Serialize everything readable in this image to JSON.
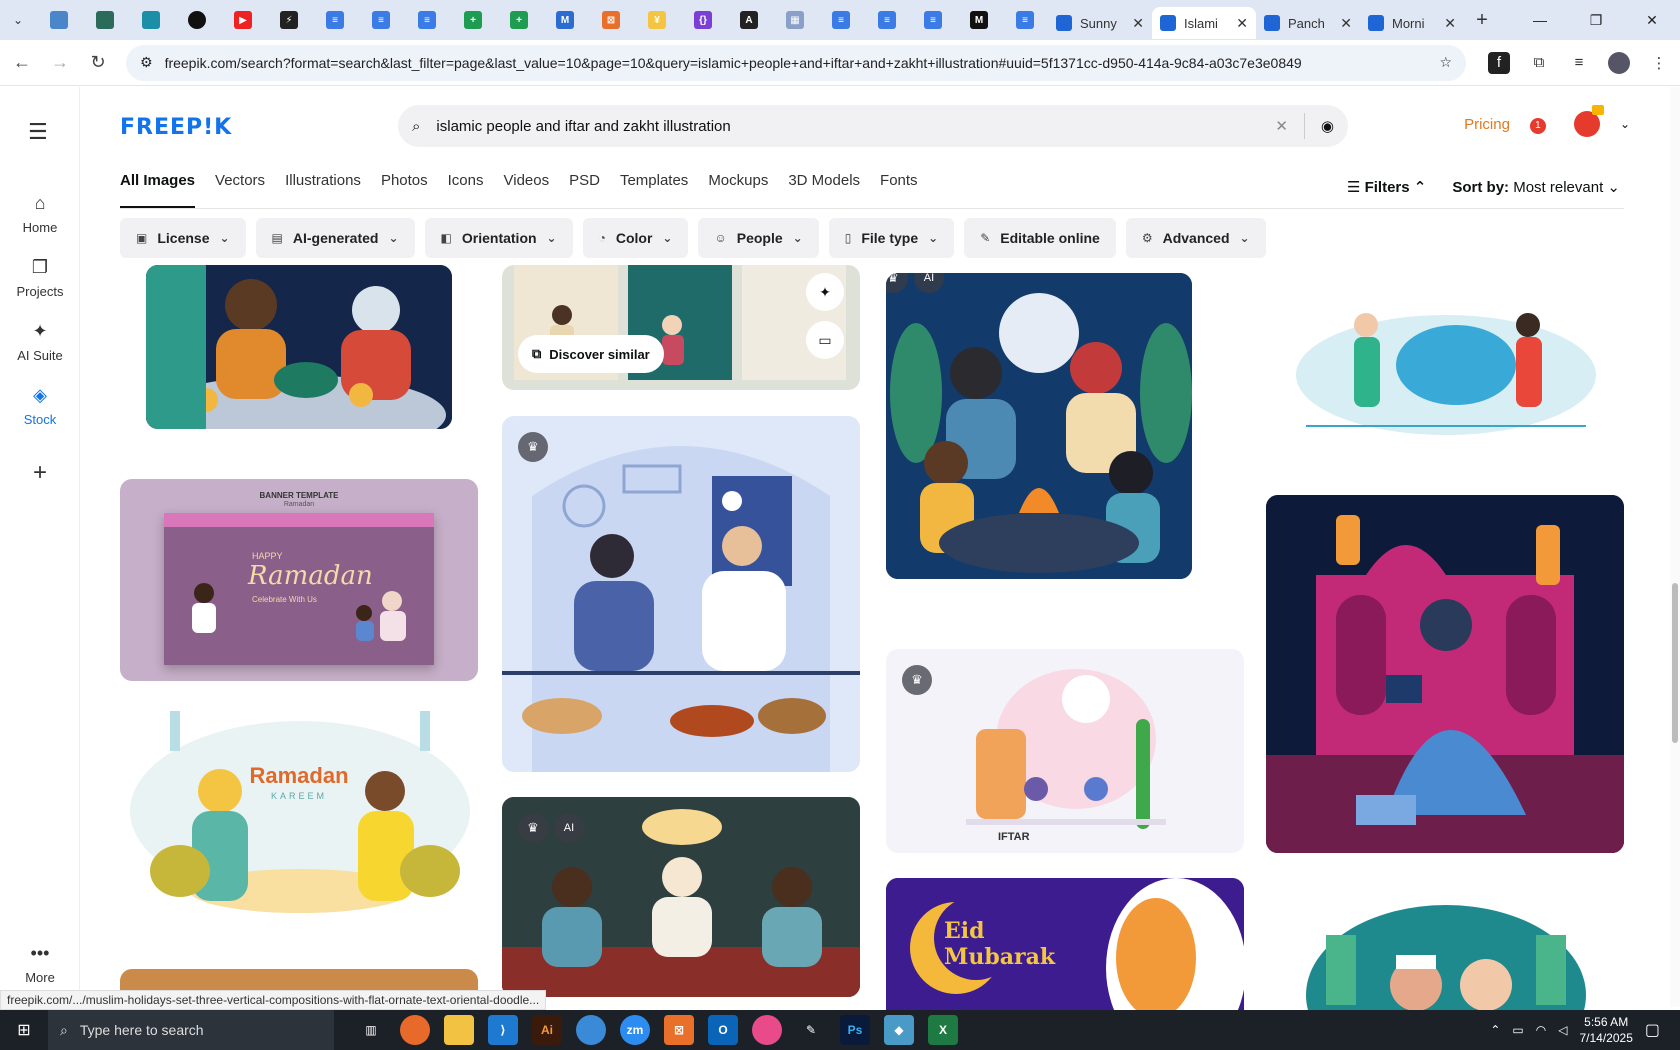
{
  "browser": {
    "tabs": [
      {
        "label": "Sunny",
        "active": false
      },
      {
        "label": "Islami",
        "active": true
      },
      {
        "label": "Panch",
        "active": false
      },
      {
        "label": "Morni",
        "active": false
      }
    ],
    "url": "freepik.com/search?format=search&last_filter=page&last_value=10&page=10&query=islamic+people+and+iftar+and+zakht+illustration#uuid=5f1371cc-d950-414a-9c84-a03c7e3e0849",
    "status_url": "freepik.com/.../muslim-holidays-set-three-vertical-compositions-with-flat-ornate-text-oriental-doodle..."
  },
  "site": {
    "logo": "FREEP!K",
    "search_query": "islamic people and iftar and zakht illustration",
    "pricing": "Pricing",
    "notification_count": "1"
  },
  "rail": {
    "items": [
      {
        "label": "Home",
        "icon": "home-icon"
      },
      {
        "label": "Projects",
        "icon": "projects-icon"
      },
      {
        "label": "AI Suite",
        "icon": "sparkle-icon"
      },
      {
        "label": "Stock",
        "icon": "stock-icon"
      }
    ],
    "more_label": "More"
  },
  "categories": [
    "All Images",
    "Vectors",
    "Illustrations",
    "Photos",
    "Icons",
    "Videos",
    "PSD",
    "Templates",
    "Mockups",
    "3D Models",
    "Fonts"
  ],
  "toolbar": {
    "filters_label": "Filters",
    "sort_label": "Sort by:",
    "sort_value": "Most relevant"
  },
  "filters": [
    "License",
    "AI-generated",
    "Orientation",
    "Color",
    "People",
    "File type",
    "Editable online",
    "Advanced"
  ],
  "cards": {
    "discover_label": "Discover similar",
    "banner_title": "BANNER TEMPLATE",
    "banner_sub": "Ramadan",
    "ramadan_text": "Ramadan",
    "ramadan_sub": "Celebrate With Us",
    "happy": "HAPPY",
    "kareem_title": "Ramadan",
    "kareem_sub": "KAREEM",
    "iftar_label": "IFTAR",
    "eid_1": "Eid",
    "eid_2": "Mubarak"
  },
  "taskbar": {
    "search_placeholder": "Type here to search",
    "time": "5:56 AM",
    "date": "7/14/2025"
  }
}
